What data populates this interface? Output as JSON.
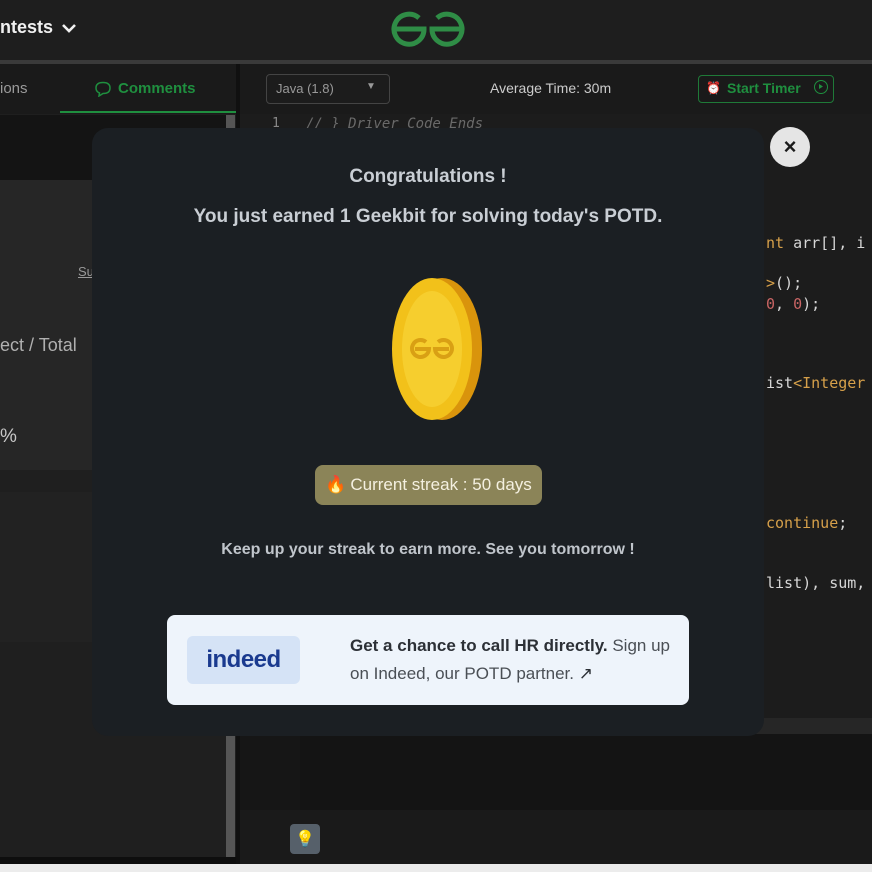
{
  "header": {
    "contests_label": "ntests",
    "logo_name": "gfg-logo"
  },
  "left_panel": {
    "tab_solutions": "ions",
    "tab_comments": "Comments",
    "sub_link": "Su",
    "correct_total": "ect / Total",
    "percent": "%"
  },
  "editor": {
    "language": "Java (1.8)",
    "average_time": "Average Time: 30m",
    "start_timer": "Start Timer",
    "line_number": "1",
    "first_line_comment": "// } Driver Code Ends",
    "code_fragments": {
      "l1_kw": "nt",
      "l1_rest": " arr[], i",
      "l2_op": ">",
      "l2_rest": "();",
      "l3_num_a": "0",
      "l3_sep": ", ",
      "l3_num_b": "0",
      "l3_end": ");",
      "l4_rest": "ist",
      "l4_kw": "<Integer",
      "l5_kw": "continue",
      "l5_end": ";",
      "l6": "list), sum,"
    }
  },
  "modal": {
    "close_symbol": "×",
    "title": "Congratulations !",
    "subtitle": "You just earned 1 Geekbit for solving today's POTD.",
    "streak_label": "Current streak : 50 days",
    "streak_emoji": "🔥",
    "keep_up": "Keep up your streak to earn more. See you tomorrow !",
    "partner": {
      "logo_text": "indeed",
      "cta_bold": "Get a chance to call HR directly.",
      "cta_rest": " Sign up on Indeed, our POTD partner.",
      "external_link_symbol": "↗"
    }
  },
  "colors": {
    "brand_green": "#1f8f3f",
    "modal_bg": "#1b1f23",
    "streak_badge": "#8b8458",
    "coin_gold": "#f2c11a"
  }
}
